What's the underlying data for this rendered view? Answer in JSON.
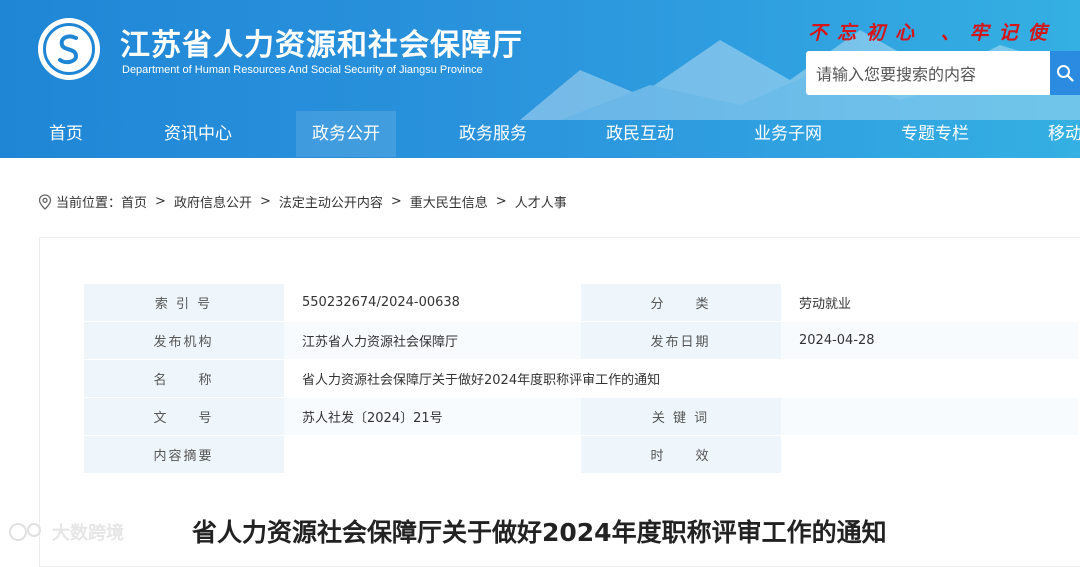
{
  "header": {
    "title_cn": "江苏省人力资源和社会保障厅",
    "title_en": "Department of Human Resources And Social Security of Jiangsu Province",
    "slogan": "不忘初心  、牢记使",
    "search_placeholder": "请输入您要搜索的内容",
    "accent_color": "#1f86d6",
    "slogan_color": "#d4161a"
  },
  "nav": {
    "items": [
      "首页",
      "资讯中心",
      "政务公开",
      "政务服务",
      "政民互动",
      "业务子网",
      "专题专栏",
      "移动"
    ],
    "active": "政务公开"
  },
  "breadcrumb": {
    "label": "当前位置：",
    "items": [
      "首页",
      "政府信息公开",
      "法定主动公开内容",
      "重大民生信息",
      "人才人事"
    ]
  },
  "meta": {
    "index_label": "索 引 号",
    "index_value": "550232674/2024-00638",
    "category_label": "分　　类",
    "category_value": "劳动就业",
    "publisher_label": "发布机构",
    "publisher_value": "江苏省人力资源社会保障厅",
    "date_label": "发布日期",
    "date_value": "2024-04-28",
    "name_label": "名　　称",
    "name_value": "省人力资源社会保障厅关于做好2024年度职称评审工作的通知",
    "docno_label": "文　　号",
    "docno_value": "苏人社发〔2024〕21号",
    "keywords_label": "关 键 词",
    "keywords_value": "",
    "summary_label": "内容摘要",
    "summary_value": "",
    "validity_label": "时　　效",
    "validity_value": ""
  },
  "document": {
    "title": "省人力资源社会保障厅关于做好2024年度职称评审工作的通知"
  },
  "watermark": {
    "text": "大数跨境"
  }
}
